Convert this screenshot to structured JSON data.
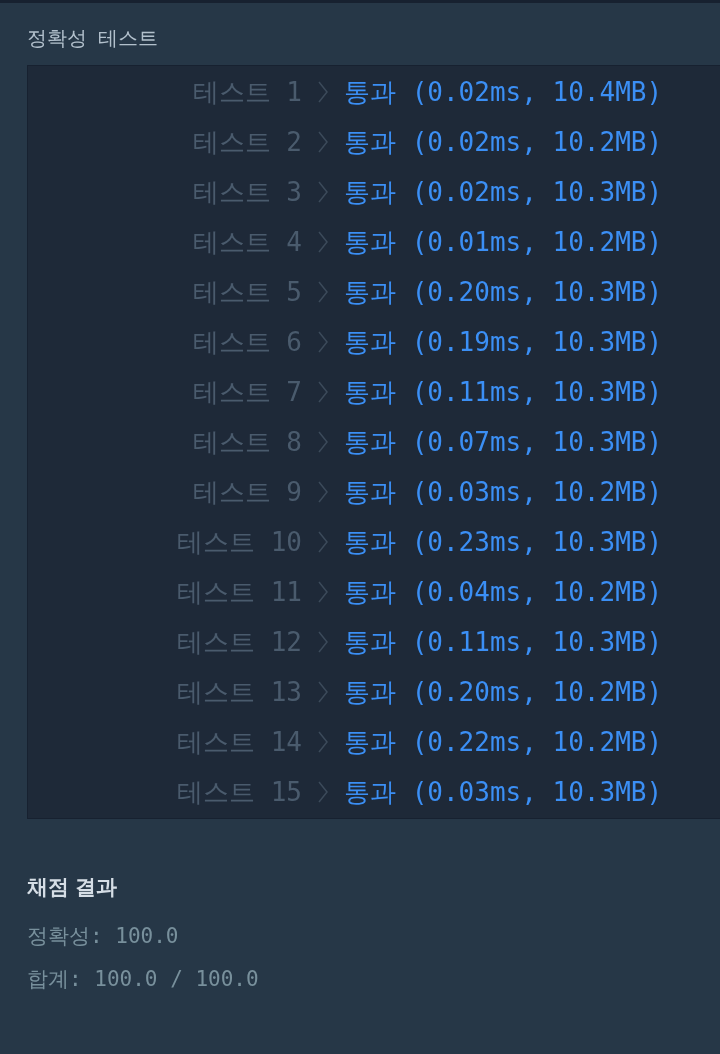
{
  "section_title": "정확성  테스트",
  "tests": [
    {
      "label": "테스트 1",
      "passed": true,
      "result": "통과 (0.02ms, 10.4MB)"
    },
    {
      "label": "테스트 2",
      "passed": true,
      "result": "통과 (0.02ms, 10.2MB)"
    },
    {
      "label": "테스트 3",
      "passed": true,
      "result": "통과 (0.02ms, 10.3MB)"
    },
    {
      "label": "테스트 4",
      "passed": true,
      "result": "통과 (0.01ms, 10.2MB)"
    },
    {
      "label": "테스트 5",
      "passed": true,
      "result": "통과 (0.20ms, 10.3MB)"
    },
    {
      "label": "테스트 6",
      "passed": true,
      "result": "통과 (0.19ms, 10.3MB)"
    },
    {
      "label": "테스트 7",
      "passed": true,
      "result": "통과 (0.11ms, 10.3MB)"
    },
    {
      "label": "테스트 8",
      "passed": true,
      "result": "통과 (0.07ms, 10.3MB)"
    },
    {
      "label": "테스트 9",
      "passed": true,
      "result": "통과 (0.03ms, 10.2MB)"
    },
    {
      "label": "테스트 10",
      "passed": true,
      "result": "통과 (0.23ms, 10.3MB)"
    },
    {
      "label": "테스트 11",
      "passed": true,
      "result": "통과 (0.04ms, 10.2MB)"
    },
    {
      "label": "테스트 12",
      "passed": true,
      "result": "통과 (0.11ms, 10.3MB)"
    },
    {
      "label": "테스트 13",
      "passed": true,
      "result": "통과 (0.20ms, 10.2MB)"
    },
    {
      "label": "테스트 14",
      "passed": true,
      "result": "통과 (0.22ms, 10.2MB)"
    },
    {
      "label": "테스트 15",
      "passed": true,
      "result": "통과 (0.03ms, 10.3MB)"
    }
  ],
  "grading": {
    "title": "채점 결과",
    "lines": [
      "정확성: 100.0",
      "합계: 100.0 / 100.0"
    ]
  }
}
